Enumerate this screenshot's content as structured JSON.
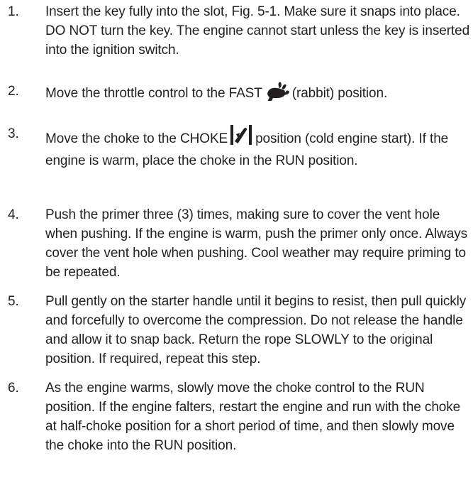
{
  "steps": [
    {
      "number": "1.",
      "text": "Insert the key fully into the slot, Fig. 5-1. Make sure it snaps into place. DO NOT turn the key. The engine cannot start unless the key is inserted into the ignition switch."
    },
    {
      "number": "2.",
      "text_before": "Move the throttle control to the FAST",
      "icon": "rabbit-icon",
      "text_after": "(rabbit) position."
    },
    {
      "number": "3.",
      "text_before": "Move the choke to the CHOKE",
      "icon": "choke-icon",
      "text_after": "position (cold engine start). If the engine is warm, place the choke in the RUN position."
    },
    {
      "number": "4.",
      "text": "Push the primer three (3) times, making sure to cover the vent hole when pushing. If the engine is warm, push the primer only once. Always cover the vent hole when pushing. Cool weather may require priming to be repeated."
    },
    {
      "number": "5.",
      "text": "Pull gently on the starter handle until it begins to resist, then pull quickly and forcefully to overcome the compression. Do not release the handle and allow it to snap back. Return the rope SLOWLY to the original position. If required, repeat this step."
    },
    {
      "number": "6.",
      "text": "As the engine warms, slowly move the choke control to the RUN position. If the engine falters, restart the engine and run with the choke at half-choke position for a short period of time, and then slowly move the choke into the RUN position."
    }
  ]
}
